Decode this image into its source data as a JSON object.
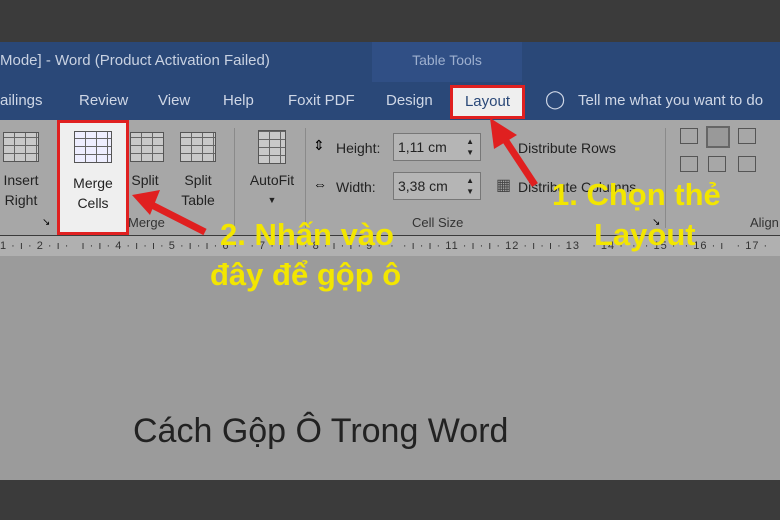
{
  "window": {
    "title": "Mode]  -  Word (Product Activation Failed)",
    "contextual_tab_group": "Table Tools"
  },
  "tabs": [
    "ailings",
    "Review",
    "View",
    "Help",
    "Foxit PDF",
    "Design",
    "Layout"
  ],
  "active_tab": "Layout",
  "tell_me": "Tell me what you want to do",
  "ribbon": {
    "insert_right": [
      "Insert",
      "Right"
    ],
    "merge_cells": [
      "Merge",
      "Cells"
    ],
    "split_cells": [
      "Split",
      "C"
    ],
    "split_table": [
      "Split",
      "Table"
    ],
    "merge_group": "Merge",
    "autofit": "AutoFit",
    "height_label": "Height:",
    "height_value": "1,11 cm",
    "width_label": "Width:",
    "width_value": "3,38 cm",
    "distribute_rows": "Distribute Rows",
    "distribute_columns": "Distribute Columns",
    "cell_size_group": "Cell Size",
    "alignment_group": "Align"
  },
  "ruler": "1 · ı · 2 · ı ·   ı · ı · 4 · ı · ı · 5 · ı · ı · 6 ·   · 7 · ı · ı · 8 · ı · ı · 9 ·  ·  · ı · ı · 11 · ı · ı · 12 · ı · ı · 13   · 14 ·  ·  · 15 ·  · 16 · ı   · 17 ·",
  "document": {
    "text": "Cách Gộp Ô Trong Word"
  },
  "annotations": {
    "step1": [
      "1. Chọn thẻ",
      "Layout"
    ],
    "step2": [
      "2. Nhấn vào",
      "đây để gộp ô"
    ]
  },
  "colors": {
    "highlight": "#e02020",
    "annotation_text": "#f3e600",
    "title_bar": "#2a4878"
  }
}
